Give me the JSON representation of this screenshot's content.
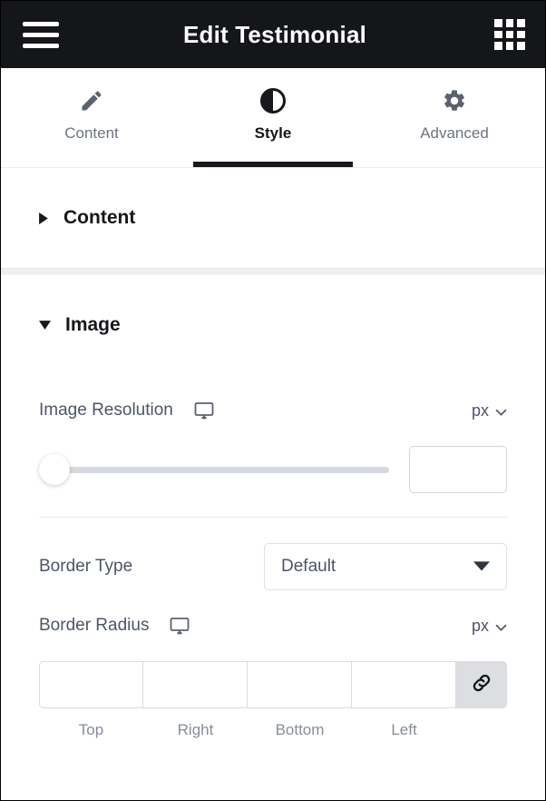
{
  "header": {
    "title": "Edit Testimonial",
    "menu_icon": "hamburger-menu-icon",
    "apps_icon": "apps-grid-icon"
  },
  "tabs": [
    {
      "label": "Content",
      "icon": "pencil-icon",
      "active": false
    },
    {
      "label": "Style",
      "icon": "contrast-icon",
      "active": true
    },
    {
      "label": "Advanced",
      "icon": "gear-icon",
      "active": false
    }
  ],
  "sections": [
    {
      "title": "Content",
      "expanded": false,
      "caret": "caret-right-icon"
    },
    {
      "title": "Image",
      "expanded": true,
      "caret": "caret-down-icon"
    }
  ],
  "controls": {
    "image_resolution": {
      "label": "Image Resolution",
      "device_icon": "desktop-monitor-icon",
      "unit": "px",
      "unit_caret": "chevron-down-icon",
      "slider_value": 0,
      "slider_min": 0,
      "slider_max": 100,
      "input_value": "",
      "input_placeholder": ""
    },
    "border_type": {
      "label": "Border Type",
      "value": "Default",
      "caret": "triangle-down-icon"
    },
    "border_radius": {
      "label": "Border Radius",
      "device_icon": "desktop-monitor-icon",
      "unit": "px",
      "unit_caret": "chevron-down-icon",
      "link_icon": "link-chain-icon",
      "fields": [
        {
          "caption": "Top",
          "value": ""
        },
        {
          "caption": "Right",
          "value": ""
        },
        {
          "caption": "Bottom",
          "value": ""
        },
        {
          "caption": "Left",
          "value": ""
        }
      ]
    }
  },
  "colors": {
    "header_bg": "#15161a",
    "accent": "#16181c",
    "label": "#4d5666",
    "muted": "#868e9b",
    "border": "#d8dbe0"
  }
}
